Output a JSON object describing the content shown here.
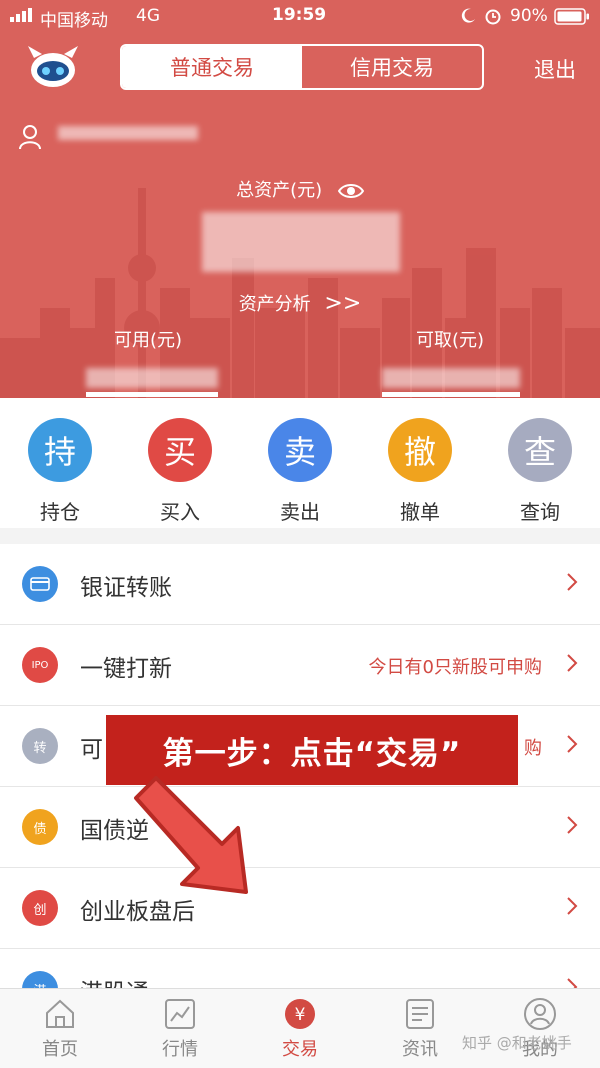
{
  "status_bar": {
    "carrier": "中国移动",
    "network": "4G",
    "time": "19:59",
    "battery": "90%"
  },
  "header": {
    "tabs": [
      {
        "label": "普通交易",
        "active": true
      },
      {
        "label": "信用交易",
        "active": false
      }
    ],
    "logout": "退出",
    "total_assets_label": "总资产(元)",
    "analysis_label": "资产分析",
    "analysis_arrow": ">>",
    "available_label": "可用(元)",
    "withdrawable_label": "可取(元)",
    "accent": "#d9625c"
  },
  "quick_actions": [
    {
      "glyph": "持",
      "label": "持仓",
      "color": "#3d9be0"
    },
    {
      "glyph": "买",
      "label": "买入",
      "color": "#e04a45"
    },
    {
      "glyph": "卖",
      "label": "卖出",
      "color": "#4a86e8"
    },
    {
      "glyph": "撤",
      "label": "撤单",
      "color": "#f0a31e"
    },
    {
      "glyph": "查",
      "label": "查询",
      "color": "#a6abc0"
    }
  ],
  "menu": [
    {
      "label": "银证转账",
      "extra": "",
      "icon": "card-icon",
      "icon_text": "",
      "color": "#3d8ee0"
    },
    {
      "label": "一键打新",
      "extra": "今日有0只新股可申购",
      "icon": "ipo-icon",
      "icon_text": "IPO",
      "color": "#e04a45"
    },
    {
      "label": "可",
      "extra": "购",
      "icon": "convert-icon",
      "icon_text": "转",
      "color": "#a9b0c0"
    },
    {
      "label": "国债逆",
      "extra": "",
      "icon": "bond-icon",
      "icon_text": "债",
      "color": "#f0a31e"
    },
    {
      "label": "创业板盘后",
      "extra": "",
      "icon": "chinext-icon",
      "icon_text": "创",
      "color": "#e04a45"
    },
    {
      "label": "港股通",
      "extra": "",
      "icon": "hk-icon",
      "icon_text": "港",
      "color": "#3d8ee0"
    }
  ],
  "annotation": {
    "banner_text": "第一步：点击“交易”"
  },
  "tabbar": [
    {
      "label": "首页",
      "icon": "home-icon",
      "active": false
    },
    {
      "label": "行情",
      "icon": "chart-icon",
      "active": false
    },
    {
      "label": "交易",
      "icon": "trade-icon",
      "active": true
    },
    {
      "label": "资讯",
      "icon": "news-icon",
      "active": false
    },
    {
      "label": "我的",
      "icon": "profile-icon",
      "active": false
    }
  ],
  "watermark": "知乎 @和老姚手"
}
